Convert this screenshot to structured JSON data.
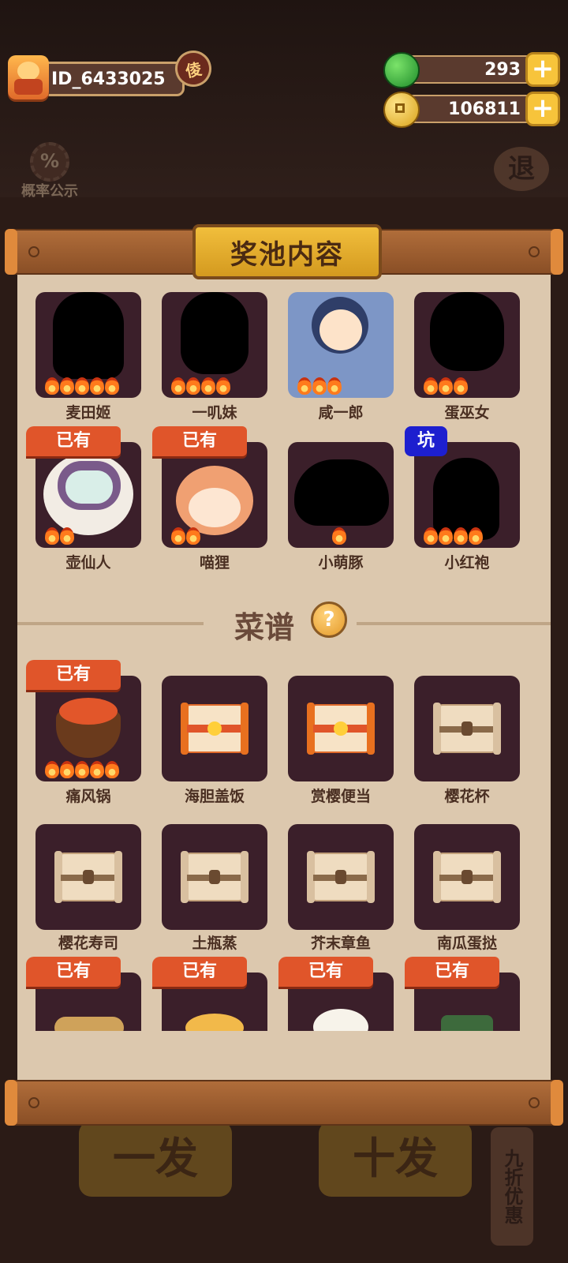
{
  "hud": {
    "player_id": "ID_6433025",
    "player_badge": "倰",
    "gems": "293",
    "coins": "106811",
    "add_symbol": "+",
    "odds_label": "概率公示",
    "odds_icon_text": "%",
    "exit_label": "退"
  },
  "dialog": {
    "title": "奖池内容"
  },
  "characters": [
    {
      "name": "麦田姬",
      "stars": 5,
      "owned": false,
      "tag": "",
      "art": "silhouette"
    },
    {
      "name": "一叽妹",
      "stars": 4,
      "owned": false,
      "tag": "",
      "art": "silhouette"
    },
    {
      "name": "咸一郎",
      "stars": 3,
      "owned": false,
      "tag": "",
      "art": "character"
    },
    {
      "name": "蛋巫女",
      "stars": 3,
      "owned": false,
      "tag": "",
      "art": "silhouette"
    },
    {
      "name": "壶仙人",
      "stars": 2,
      "owned": true,
      "tag": "已有",
      "art": "character"
    },
    {
      "name": "喵狸",
      "stars": 2,
      "owned": true,
      "tag": "已有",
      "art": "character"
    },
    {
      "name": "小萌豚",
      "stars": 1,
      "owned": false,
      "tag": "",
      "art": "silhouette"
    },
    {
      "name": "小红袍",
      "stars": 4,
      "owned": false,
      "tag": "坑",
      "art": "silhouette"
    }
  ],
  "recipes_section": {
    "title": "菜谱",
    "help_symbol": "?"
  },
  "recipes": [
    {
      "name": "痛风锅",
      "stars": 5,
      "owned": true,
      "tag": "已有",
      "art": "dish"
    },
    {
      "name": "海胆盖饭",
      "stars": 0,
      "owned": false,
      "tag": "",
      "art": "scroll-red"
    },
    {
      "name": "赏樱便当",
      "stars": 0,
      "owned": false,
      "tag": "",
      "art": "scroll-red"
    },
    {
      "name": "樱花杯",
      "stars": 0,
      "owned": false,
      "tag": "",
      "art": "scroll"
    },
    {
      "name": "樱花寿司",
      "stars": 0,
      "owned": false,
      "tag": "",
      "art": "scroll"
    },
    {
      "name": "土瓶蒸",
      "stars": 0,
      "owned": false,
      "tag": "",
      "art": "scroll"
    },
    {
      "name": "芥末章鱼",
      "stars": 0,
      "owned": false,
      "tag": "",
      "art": "scroll"
    },
    {
      "name": "南瓜蛋挞",
      "stars": 0,
      "owned": false,
      "tag": "",
      "art": "scroll"
    },
    {
      "name": "",
      "stars": 0,
      "owned": true,
      "tag": "已有",
      "art": "dish"
    },
    {
      "name": "",
      "stars": 0,
      "owned": true,
      "tag": "已有",
      "art": "dish"
    },
    {
      "name": "",
      "stars": 0,
      "owned": true,
      "tag": "已有",
      "art": "dish"
    },
    {
      "name": "",
      "stars": 0,
      "owned": true,
      "tag": "已有",
      "art": "dish"
    }
  ],
  "background_buttons": {
    "single": "一发",
    "ten": "十发",
    "discount": "九折优惠"
  },
  "colors": {
    "owned_tag": "#e0552a",
    "pit_tag": "#1d1fcf",
    "card_bg": "#3b1f2a",
    "panel_bg": "#dcc8ae",
    "title_plate": "#f1be3c"
  }
}
